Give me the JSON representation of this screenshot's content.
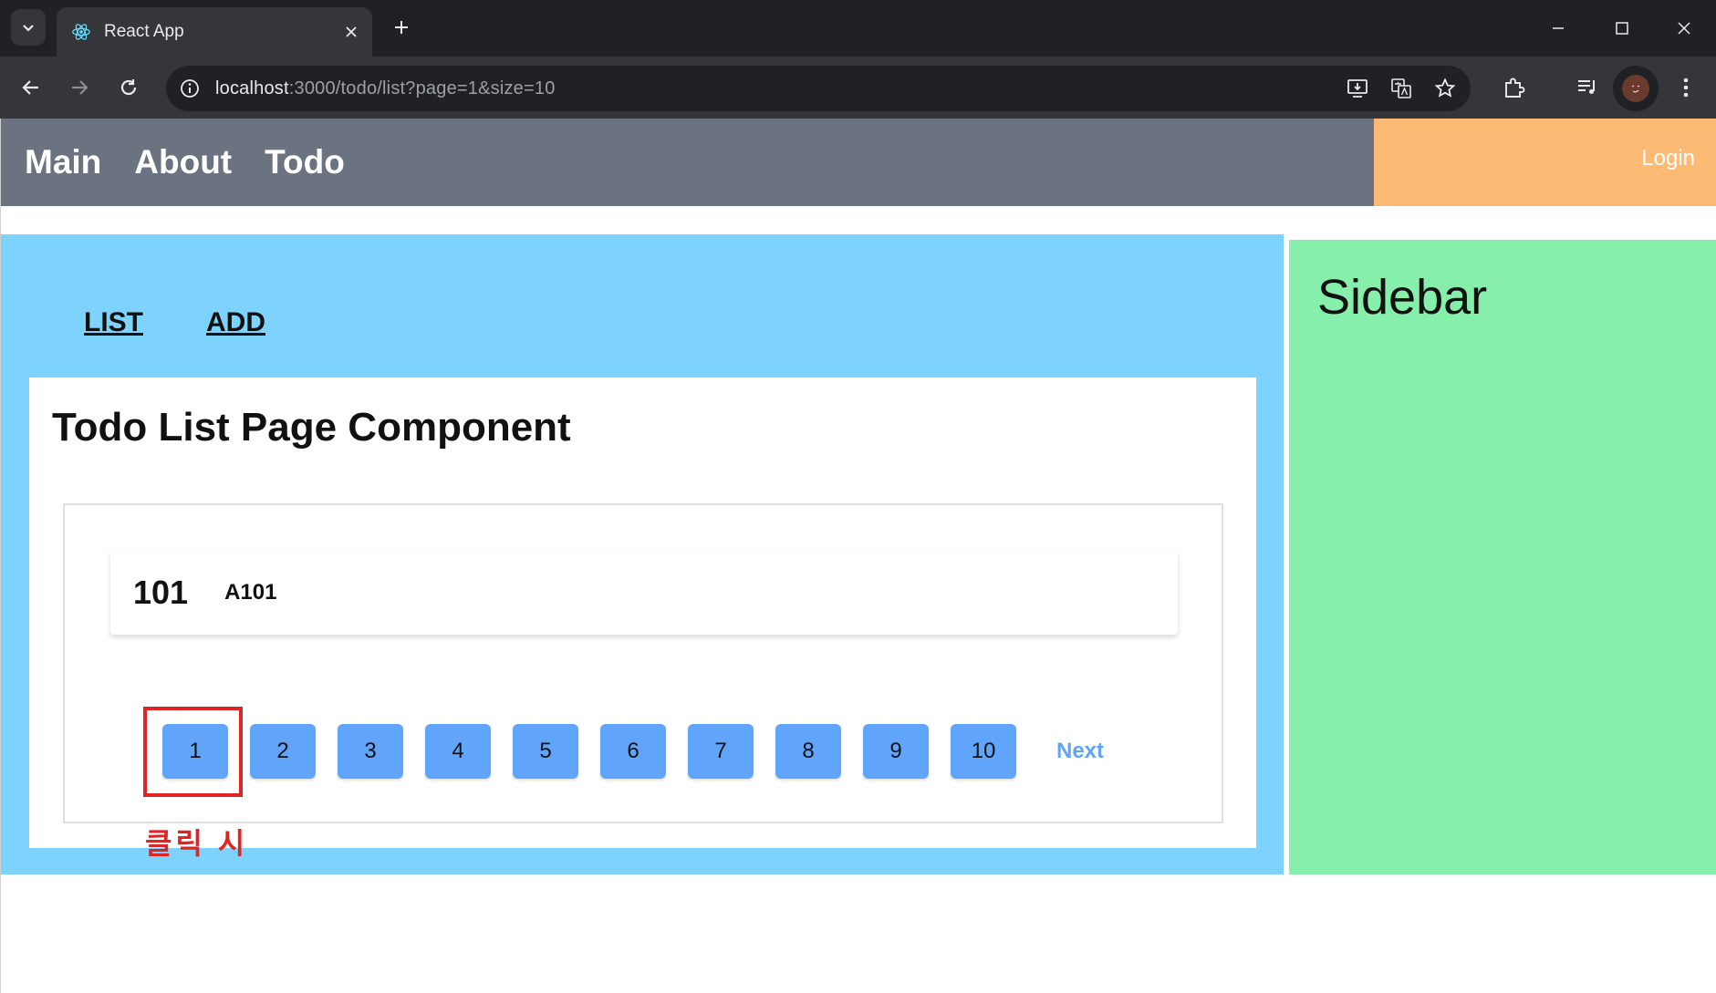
{
  "browser": {
    "tab_title": "React App",
    "url_host": "localhost",
    "url_rest": ":3000/todo/list?page=1&size=10"
  },
  "app_nav": {
    "links": [
      "Main",
      "About",
      "Todo"
    ],
    "login": "Login"
  },
  "todo_layout": {
    "sub_links": [
      "LIST",
      "ADD"
    ]
  },
  "page": {
    "heading": "Todo List Page Component",
    "items": [
      {
        "tno": "101",
        "title": "A101"
      }
    ],
    "pages": [
      "1",
      "2",
      "3",
      "4",
      "5",
      "6",
      "7",
      "8",
      "9",
      "10"
    ],
    "next": "Next",
    "current_page": "1"
  },
  "annotation": {
    "text": "클릭 시",
    "color": "#e02424"
  },
  "sidebar": {
    "title": "Sidebar"
  },
  "colors": {
    "nav_bg": "#6b7280",
    "login_bg": "#fdba74",
    "main_bg": "#7dd3fc",
    "sidebar_bg": "#86efac",
    "page_button": "#60a5fa"
  }
}
